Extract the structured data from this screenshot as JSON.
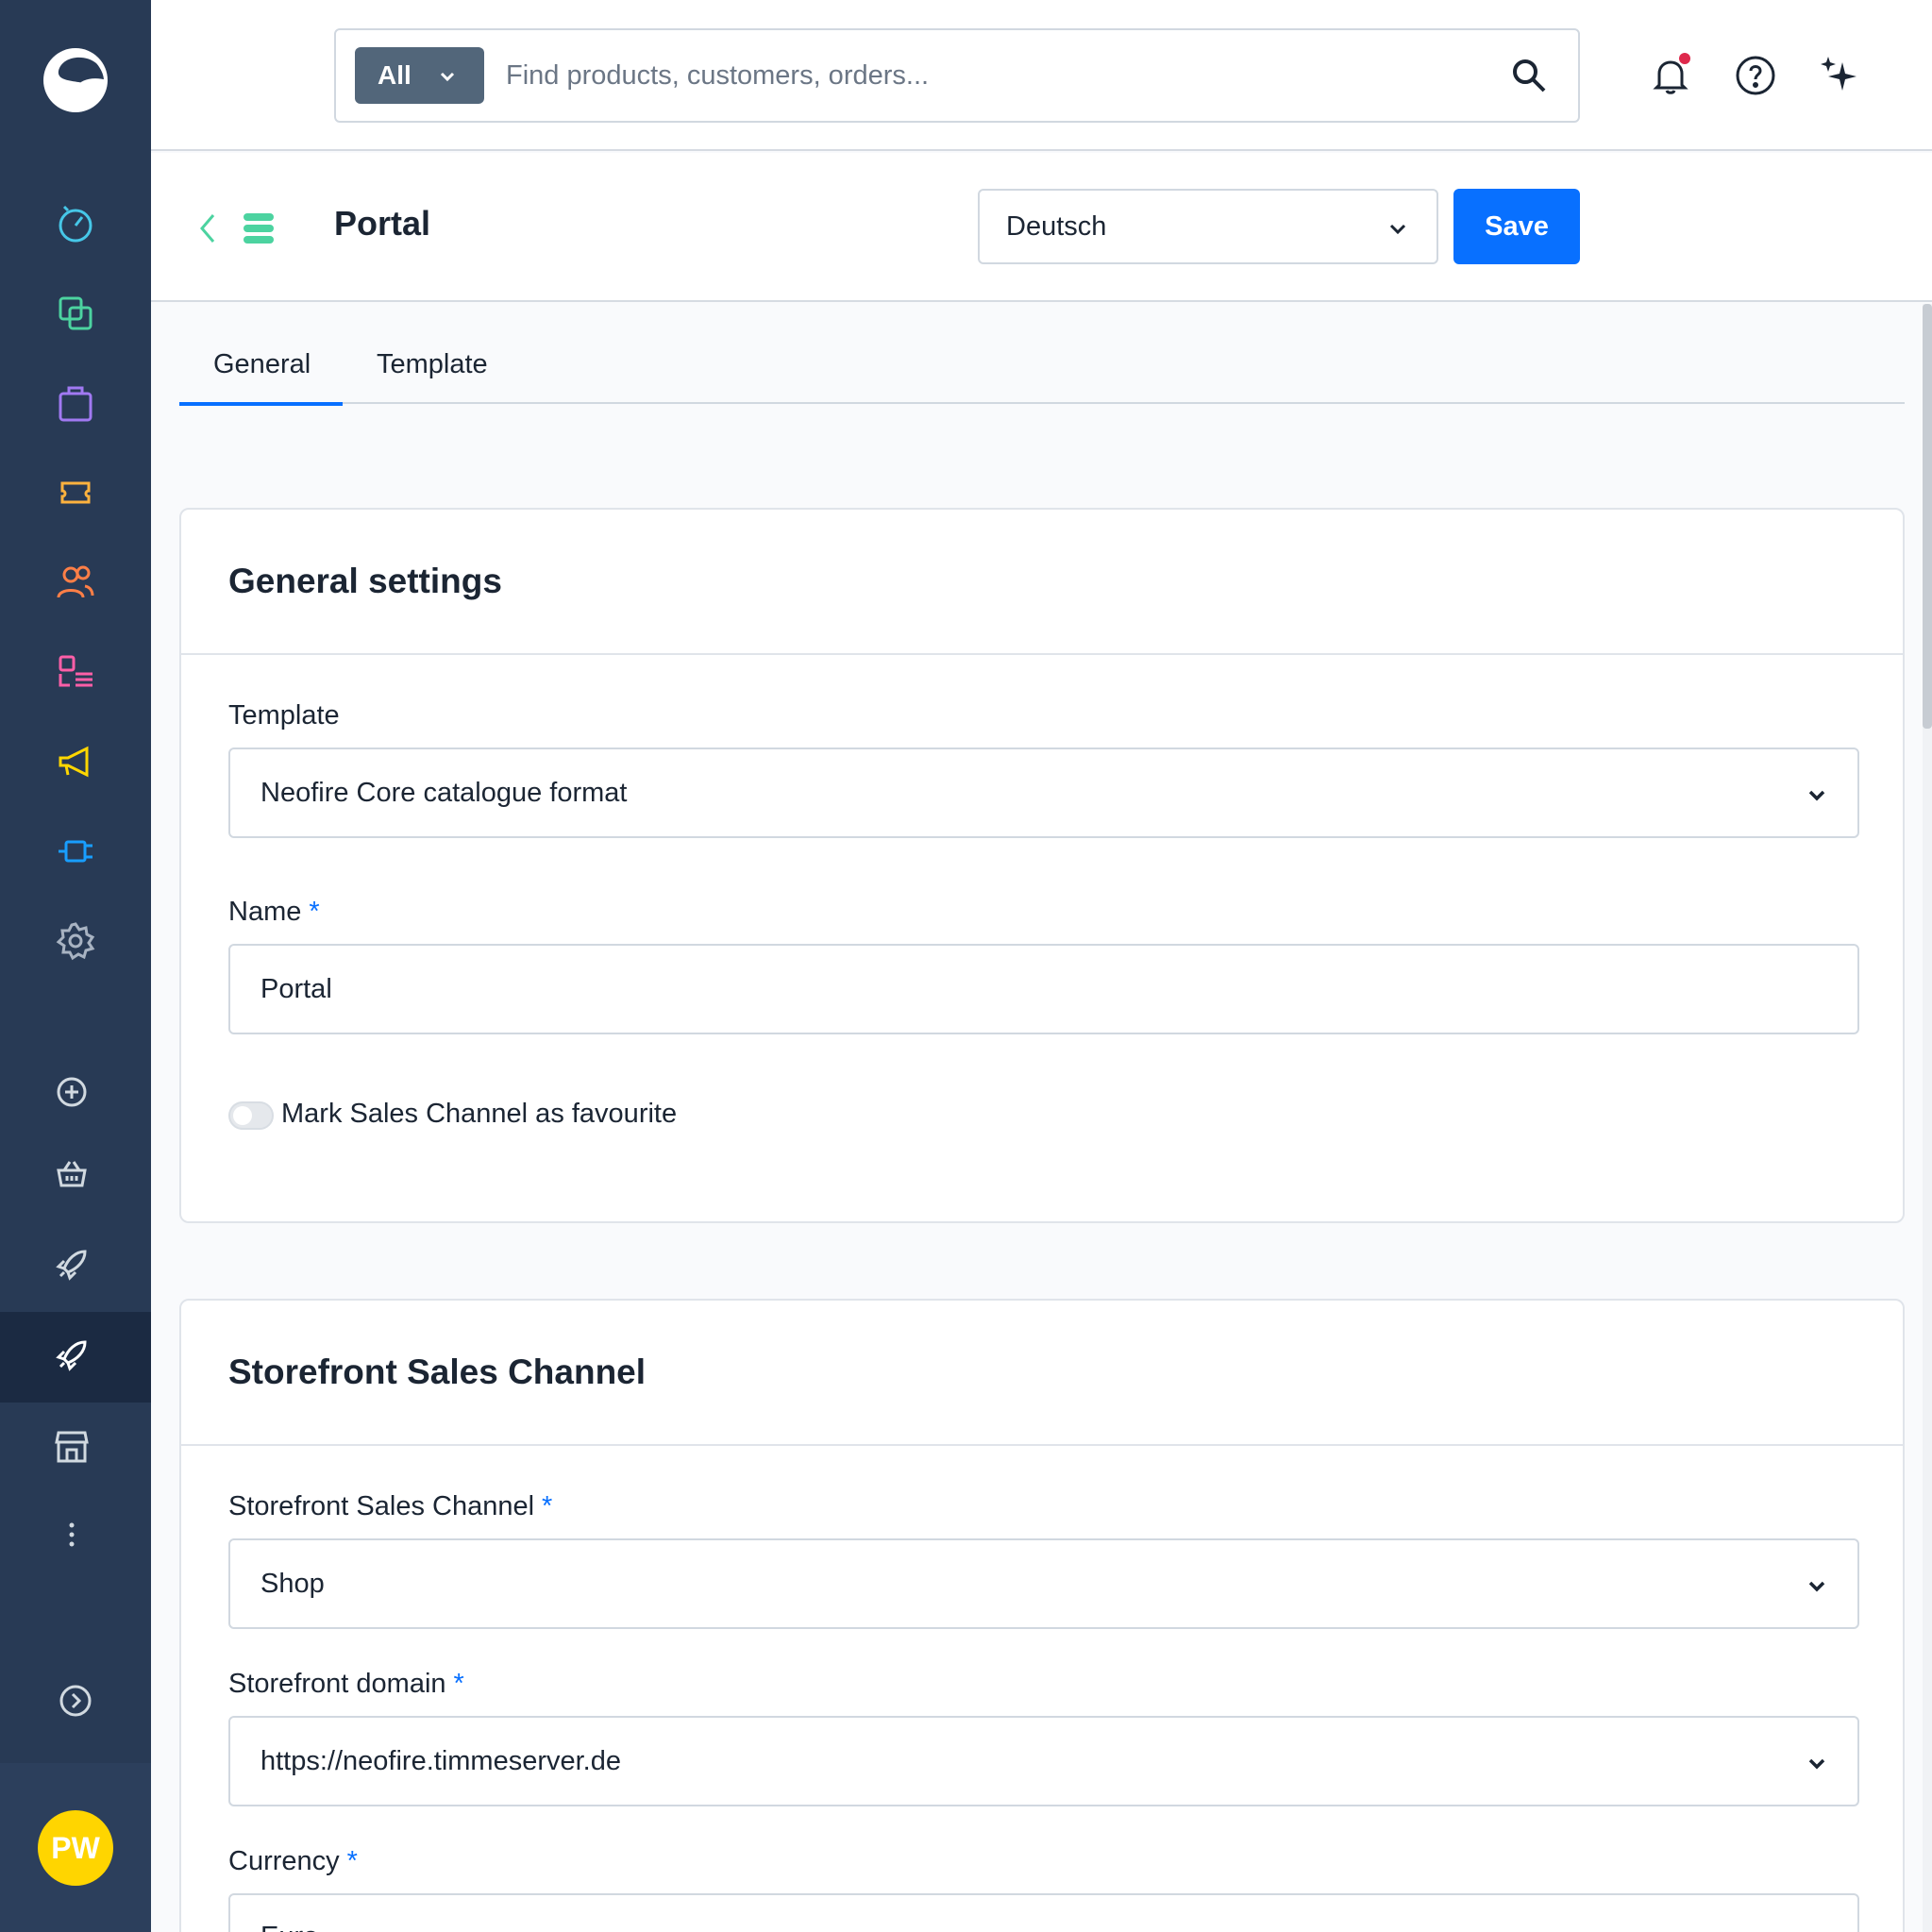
{
  "search": {
    "type_label": "All",
    "placeholder": "Find products, customers, orders..."
  },
  "page": {
    "title": "Portal",
    "language": "Deutsch",
    "save_label": "Save"
  },
  "tabs": [
    {
      "label": "General",
      "active": true
    },
    {
      "label": "Template",
      "active": false
    }
  ],
  "general_settings": {
    "title": "General settings",
    "template_label": "Template",
    "template_value": "Neofire Core catalogue format",
    "name_label": "Name",
    "name_value": "Portal",
    "favourite_label": "Mark Sales Channel as favourite",
    "favourite_on": false
  },
  "storefront": {
    "title": "Storefront Sales Channel",
    "channel_label": "Storefront Sales Channel",
    "channel_value": "Shop",
    "domain_label": "Storefront domain",
    "domain_value": "https://neofire.timmeserver.de",
    "currency_label": "Currency",
    "currency_value": "Euro"
  },
  "required_marker": "*",
  "user": {
    "initials": "PW"
  },
  "colors": {
    "sidebar": "#283a55",
    "primary": "#0870ff",
    "avatar": "#ffd500",
    "notification": "#de294c"
  }
}
